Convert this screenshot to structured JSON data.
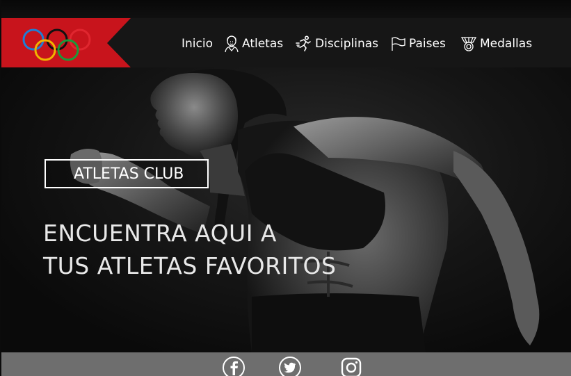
{
  "brand": {
    "logo": "olympic-rings-icon",
    "ring_colors": [
      "#1e7fd6",
      "#f0b400",
      "#111111",
      "#1a9b3a",
      "#e0262f"
    ],
    "banner_color": "#c8141c"
  },
  "nav": {
    "items": [
      {
        "label": "Inicio",
        "icon": ""
      },
      {
        "label": "Atletas",
        "icon": "athlete-icon"
      },
      {
        "label": "Disciplinas",
        "icon": "runner-icon"
      },
      {
        "label": "Paises",
        "icon": "flag-icon"
      },
      {
        "label": "Medallas",
        "icon": "medal-icon"
      }
    ]
  },
  "hero": {
    "badge": "ATLETAS CLUB",
    "title_line1": "ENCUENTRA AQUI A",
    "title_line2": "TUS ATLETAS FAVORITOS"
  },
  "footer": {
    "social": [
      "facebook-icon",
      "twitter-icon",
      "instagram-icon"
    ]
  }
}
